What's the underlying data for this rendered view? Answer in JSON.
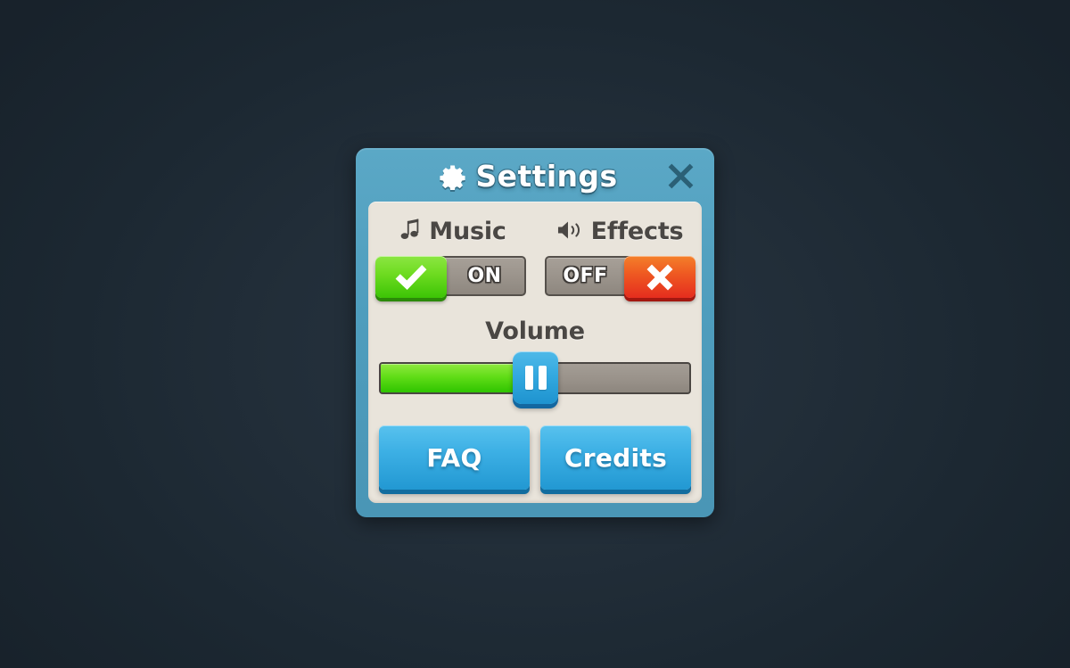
{
  "background": {
    "color_outer": "#18222b",
    "color_center": "#27343f"
  },
  "dialog": {
    "frame_color": "#4e9dbd",
    "panel_color": "#e9e4db",
    "title": "Settings",
    "title_icon": "gear-icon",
    "close_icon": "close-x-icon",
    "close_label": "Close"
  },
  "settings": {
    "rows": [
      {
        "id": "music",
        "icon": "music-note-icon",
        "label": "Music",
        "state_label": "ON",
        "state": "on",
        "knob_icon": "checkmark-icon",
        "knob_color": "#6fdc21"
      },
      {
        "id": "effects",
        "icon": "speaker-icon",
        "label": "Effects",
        "state_label": "OFF",
        "state": "off",
        "knob_icon": "cross-icon",
        "knob_color": "#ef5b22"
      }
    ]
  },
  "volume": {
    "label": "Volume",
    "value_percent": 50,
    "fill_color": "#61dd17",
    "track_color": "#99928a",
    "handle_color": "#34a9e0",
    "handle_icon": "grip-bars-icon"
  },
  "actions": {
    "buttons": [
      {
        "id": "faq",
        "label": "FAQ"
      },
      {
        "id": "credits",
        "label": "Credits"
      }
    ],
    "color": "#3db0e5"
  }
}
